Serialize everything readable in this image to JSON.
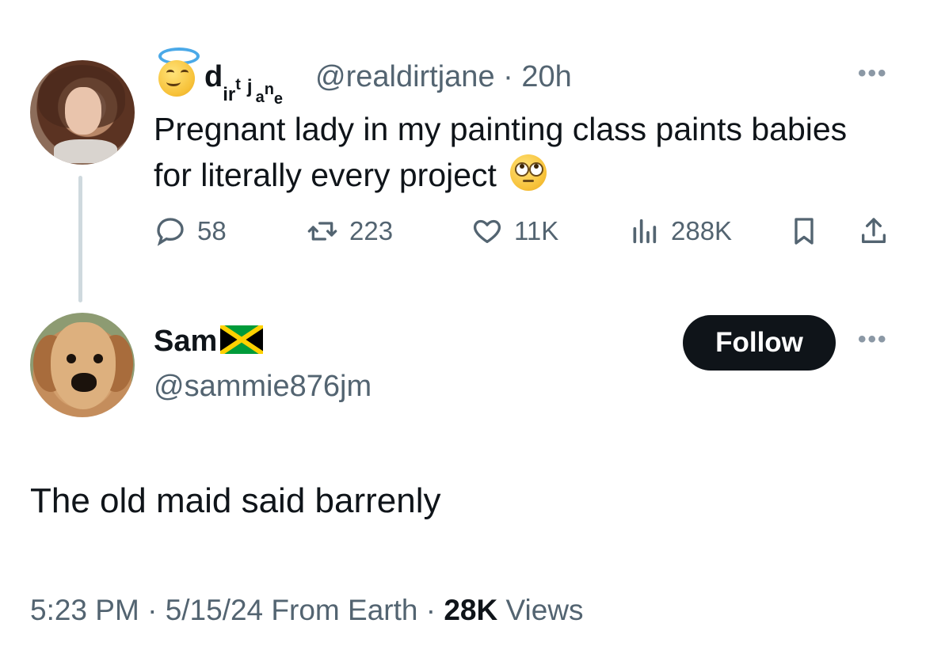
{
  "parent_tweet": {
    "display_name_chars": [
      "d",
      "i",
      "r",
      "t",
      "j",
      "a",
      "n",
      "e"
    ],
    "handle": "@realdirtjane",
    "separator": "·",
    "time": "20h",
    "more_label": "•••",
    "text": "Pregnant lady in my painting class paints babies for literally every project",
    "actions": {
      "replies": "58",
      "retweets": "223",
      "likes": "11K",
      "views": "288K"
    },
    "icons": [
      "angel-emoji-icon",
      "face-with-rolling-eyes-icon",
      "reply-icon",
      "retweet-icon",
      "like-icon",
      "views-icon",
      "bookmark-icon",
      "share-icon"
    ]
  },
  "reply_tweet": {
    "display_name": "Sam",
    "flag": "jamaica-flag-icon",
    "handle": "@sammie876jm",
    "follow_label": "Follow",
    "more_label": "•••",
    "text": "The old maid said barrenly"
  },
  "meta": {
    "time": "5:23 PM",
    "sep1": "·",
    "date": "5/15/24",
    "source": "From Earth",
    "sep2": "·",
    "views_count": "28K",
    "views_label": "Views"
  },
  "colors": {
    "text": "#0f1419",
    "secondary": "#536471",
    "follow_bg": "#0f1419",
    "thread_line": "#cfd9de",
    "flag_green": "#009b3a",
    "flag_gold": "#fed100"
  }
}
